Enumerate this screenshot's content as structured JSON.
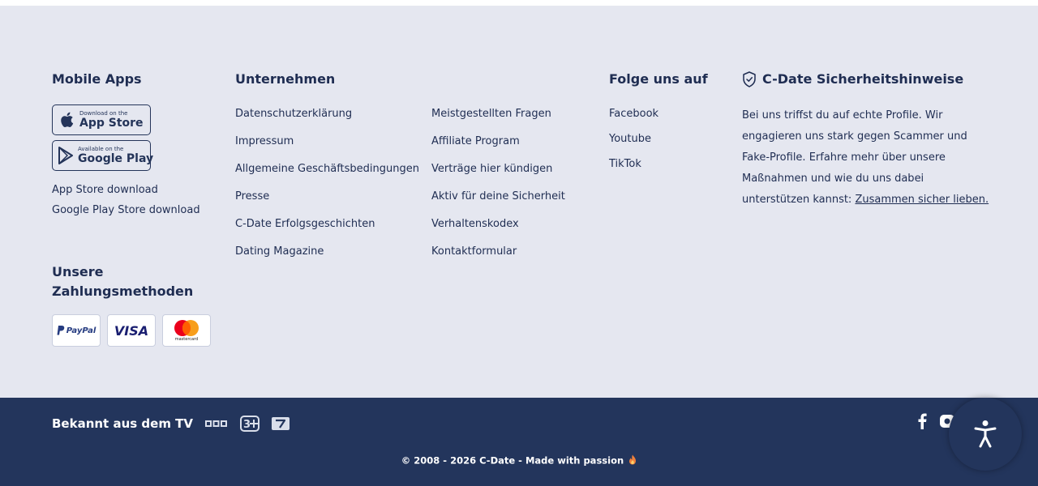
{
  "mobile_apps": {
    "heading": "Mobile Apps",
    "app_store_badge": {
      "small": "Download on the",
      "big": "App Store"
    },
    "google_play_badge": {
      "small": "Available on the",
      "big": "Google Play"
    },
    "links": [
      "App Store download",
      "Google Play Store download"
    ]
  },
  "payments": {
    "heading_line1": "Unsere",
    "heading_line2": "Zahlungsmethoden",
    "methods": [
      {
        "name": "paypal-logo",
        "label": "PayPal"
      },
      {
        "name": "visa-logo",
        "label": "VISA"
      },
      {
        "name": "mastercard-logo",
        "label": "mastercard"
      }
    ]
  },
  "company": {
    "heading": "Unternehmen",
    "col1": [
      "Datenschutzerklärung",
      "Impressum",
      "Allgemeine Geschäftsbedingungen",
      "Presse",
      "C-Date Erfolgsgeschichten",
      "Dating Magazine"
    ],
    "col2": [
      "Meistgestellten Fragen",
      "Affiliate Program",
      "Verträge hier kündigen",
      "Aktiv für deine Sicherheit",
      "Verhaltenskodex",
      "Kontaktformular"
    ]
  },
  "follow": {
    "heading": "Folge uns auf",
    "links": [
      "Facebook",
      "Youtube",
      "TikTok"
    ]
  },
  "safety": {
    "heading": "C-Date Sicherheitshinweise",
    "text": "Bei uns triffst du auf echte Profile. Wir engagieren uns stark gegen Scammer und Fake-Profile. Erfahre mehr über unsere Maßnahmen und wie du uns dabei unterstützen kannst: ",
    "link": "Zusammen sicher lieben."
  },
  "bottom": {
    "tv_label": "Bekannt aus dem TV",
    "tv_logos": [
      "rtl-logo",
      "sat1-logo",
      "prosieben-logo"
    ],
    "copyright": "© 2008 - 2026 C-Date - Made with passion",
    "social_icons": [
      "facebook-icon",
      "instagram-icon"
    ]
  },
  "colors": {
    "light_bg": "#e5e7f0",
    "dark_bg": "#23355c",
    "text": "#1f2d52"
  }
}
